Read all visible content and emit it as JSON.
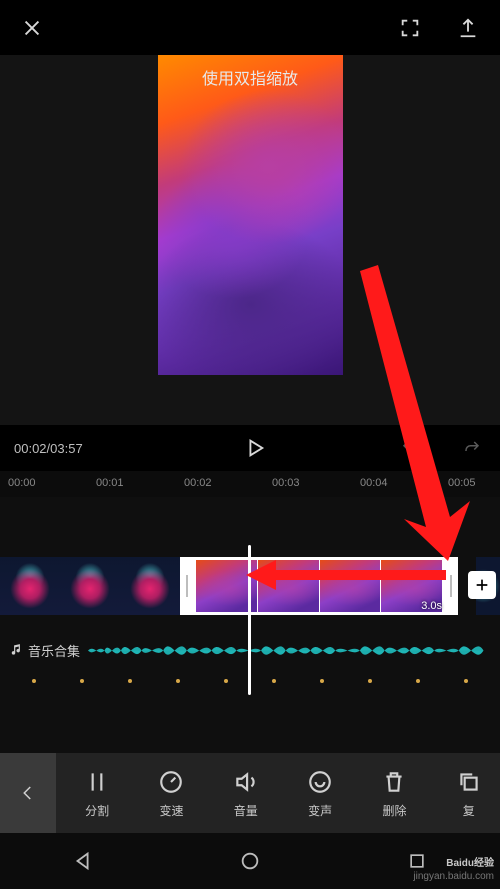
{
  "header": {
    "hint": "使用双指缩放"
  },
  "transport": {
    "current": "00:02",
    "total": "03:57"
  },
  "ruler": [
    "00:00",
    "00:01",
    "00:02",
    "00:03",
    "00:04",
    "00:05"
  ],
  "clip": {
    "duration": "3.0s"
  },
  "audio": {
    "label": "音乐合集"
  },
  "tools": {
    "split": "分割",
    "speed": "变速",
    "volume": "音量",
    "voice": "变声",
    "delete": "删除",
    "copy": "复"
  },
  "watermark": {
    "brand": "Baidu经验",
    "url": "jingyan.baidu.com"
  }
}
